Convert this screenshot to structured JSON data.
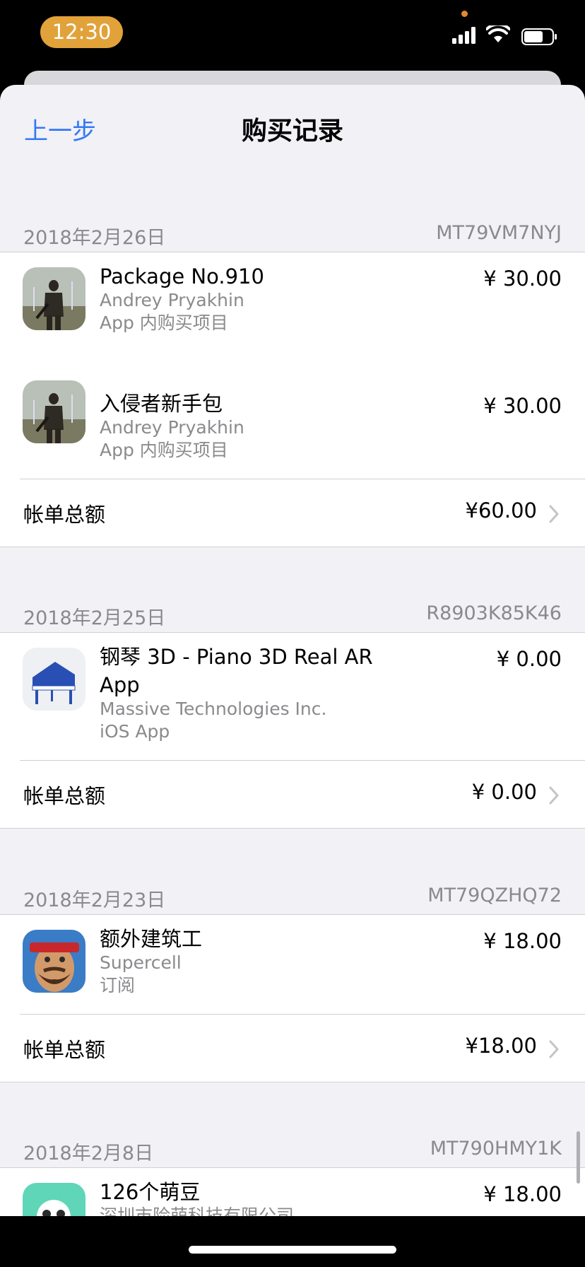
{
  "status": {
    "time": "12:30"
  },
  "nav": {
    "back_label": "上一步",
    "title": "购买记录"
  },
  "sections": [
    {
      "date": "2018年2月26日",
      "order_id": "MT79VM7NYJ",
      "items": [
        {
          "title": "Package No.910",
          "developer": "Andrey Pryakhin",
          "type": "App 内购买项目",
          "price": "¥ 30.00",
          "icon": "survivor-game-icon"
        },
        {
          "title": "入侵者新手包",
          "developer": "Andrey Pryakhin",
          "type": "App 内购买项目",
          "price": "¥ 30.00",
          "icon": "survivor-game-icon"
        }
      ],
      "total_label": "帐单总额",
      "total_value": "¥60.00"
    },
    {
      "date": "2018年2月25日",
      "order_id": "R8903K85K46",
      "items": [
        {
          "title": "钢琴 3D - Piano 3D Real AR App",
          "developer": "Massive Technologies Inc.",
          "type": "iOS App",
          "price": "¥ 0.00",
          "icon": "piano-icon"
        }
      ],
      "total_label": "帐单总额",
      "total_value": "¥ 0.00"
    },
    {
      "date": "2018年2月23日",
      "order_id": "MT79QZHQ72",
      "items": [
        {
          "title": "额外建筑工",
          "developer": "Supercell",
          "type": "订阅",
          "price": "¥ 18.00",
          "icon": "boom-beach-icon"
        }
      ],
      "total_label": "帐单总额",
      "total_value": "¥18.00"
    },
    {
      "date": "2018年2月8日",
      "order_id": "MT790HMY1K",
      "items": [
        {
          "title": "126个萌豆",
          "developer": "深圳市险萌科技有限公司",
          "price": "¥ 18.00",
          "icon": "panda-icon"
        }
      ]
    }
  ],
  "colors": {
    "accent": "#3478f6",
    "background": "#f1f1f6",
    "time_pill": "#e2a23a"
  }
}
